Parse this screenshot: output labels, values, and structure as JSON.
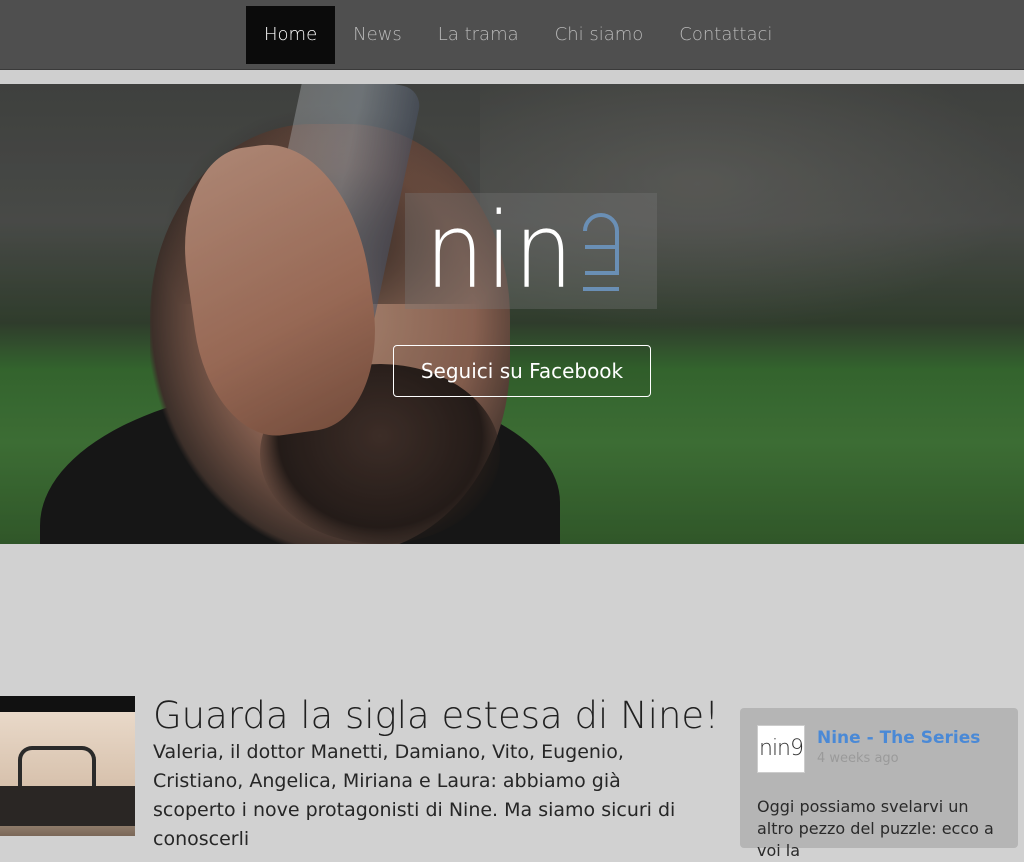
{
  "nav": {
    "items": [
      {
        "label": "Home",
        "active": true
      },
      {
        "label": "News",
        "active": false
      },
      {
        "label": "La trama",
        "active": false
      },
      {
        "label": "Chi siamo",
        "active": false
      },
      {
        "label": "Contattaci",
        "active": false
      }
    ]
  },
  "hero": {
    "logo_text": "nin",
    "logo_digit": "9",
    "cta_label": "Seguici su Facebook"
  },
  "post": {
    "title": "Guarda la sigla estesa di Nine!",
    "excerpt": "Valeria, il dottor Manetti, Damiano, Vito, Eugenio, Cristiano, Angelica, Miriana e Laura: abbiamo già scoperto i nove protagonisti di Nine. Ma siamo sicuri di conoscerli"
  },
  "facebook_widget": {
    "avatar_text": "nin9",
    "page_name": "Nine - The Series",
    "time": "4 weeks ago",
    "post_text": "Oggi possiamo svelarvi un altro pezzo del puzzle: ecco a voi la"
  },
  "colors": {
    "nav_bg": "#4f4f4f",
    "nav_active_bg": "#0b0b0b",
    "page_bg": "#d1d1d1",
    "logo_accent": "#6a8fb5",
    "link_blue": "#4a89d6"
  }
}
